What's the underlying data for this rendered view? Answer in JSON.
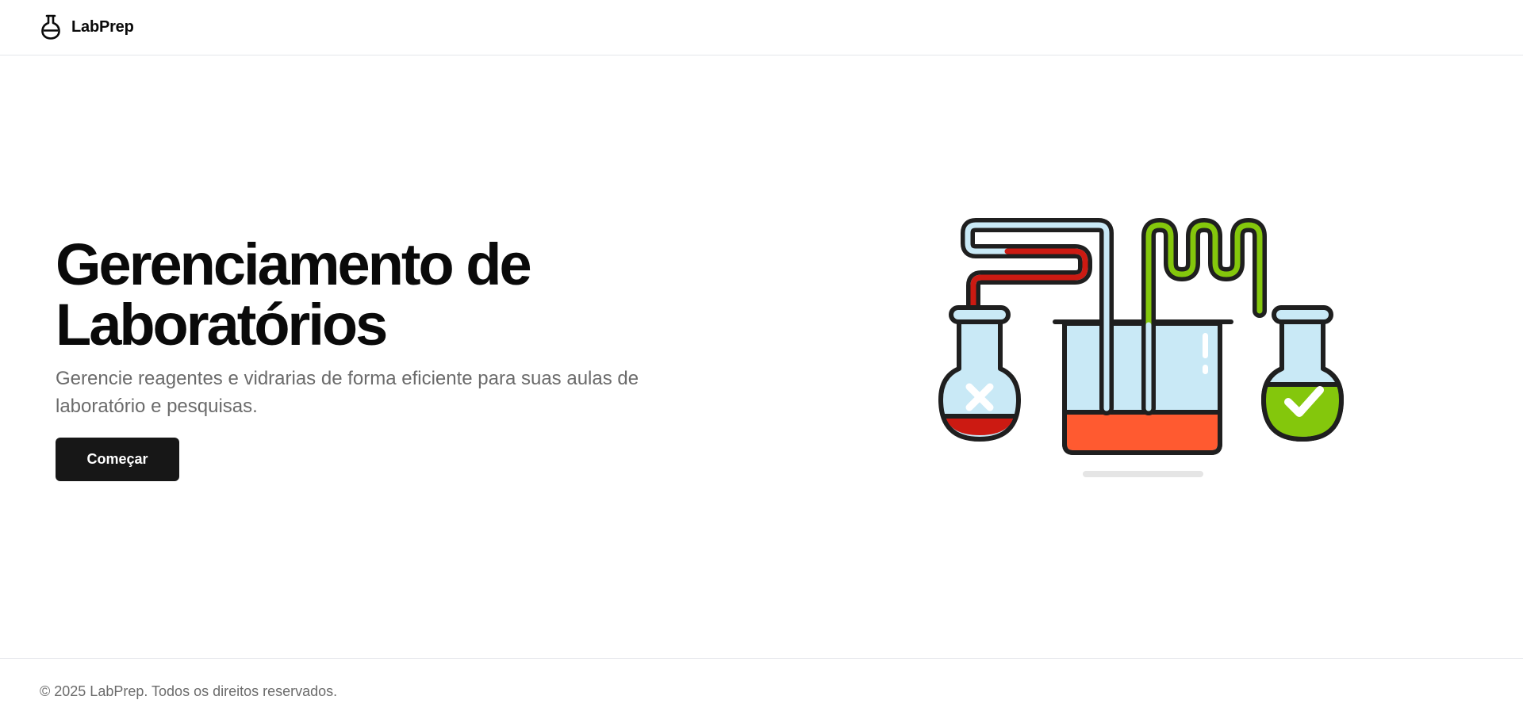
{
  "header": {
    "brand_name": "LabPrep",
    "brand_icon": "flask-icon"
  },
  "hero": {
    "title_line1": "Gerenciamento de",
    "title_line2": "Laboratórios",
    "subtitle": "Gerencie reagentes e vidrarias de forma eficiente para suas aulas de laboratório e pesquisas.",
    "cta_label": "Começar"
  },
  "illustration": {
    "name": "lab-apparatus-illustration",
    "colors": {
      "outline": "#1f1f1f",
      "glass": "#c9e9f6",
      "red_liquid": "#cc1a12",
      "orange_liquid": "#ff5a30",
      "green_liquid": "#84c70c",
      "shadow": "#e5e5e5"
    }
  },
  "footer": {
    "copyright": "© 2025 LabPrep. Todos os direitos reservados."
  }
}
